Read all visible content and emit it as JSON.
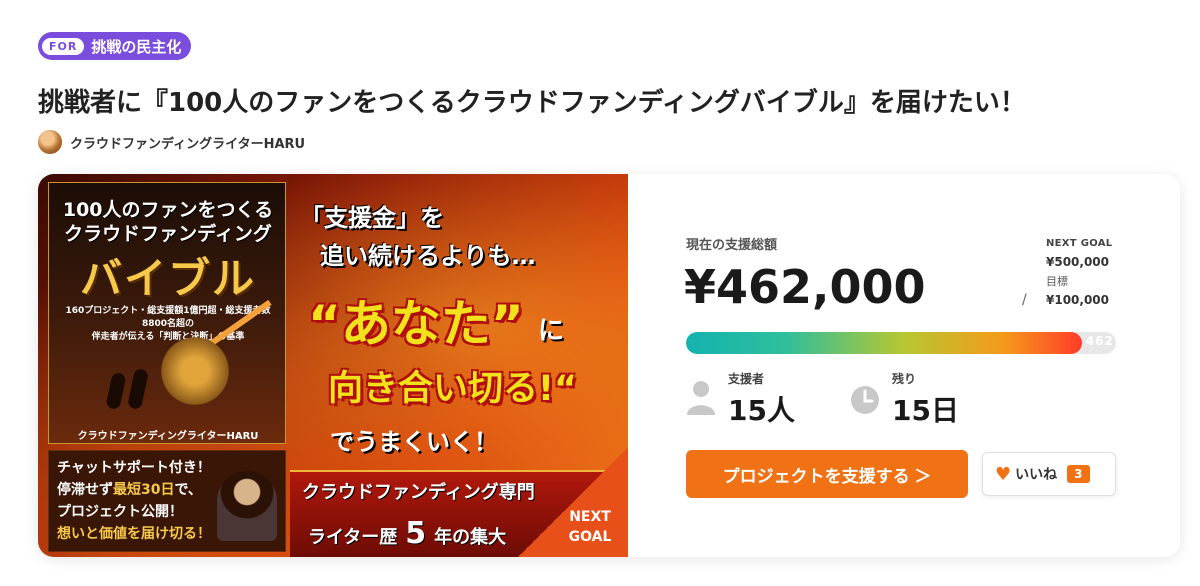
{
  "category": {
    "prefix": "FOR",
    "label": "挑戦の民主化"
  },
  "project": {
    "title": "挑戦者に『100人のファンをつくるクラウドファンディングバイブル』を届けたい！",
    "author": "クラウドファンディングライターHARU"
  },
  "image": {
    "book_title_1": "100人のファンをつくる",
    "book_title_2": "クラウドファンディング",
    "book_title_big": "バイブル",
    "book_subtitle_1": "160プロジェクト・総支援額1億円超・総支援者数8800名超の",
    "book_subtitle_2": "伴走者が伝える「判断と決断」の基準",
    "book_author": "クラウドファンディングライターHARU",
    "chat_line_1": "チャットサポート付き！",
    "chat_line_2a": "停滞せず",
    "chat_line_2b": "最短30日",
    "chat_line_2c": "で、",
    "chat_line_3": "プロジェクト公開！",
    "chat_line_4": "想いと価値を届け切る！",
    "headline_1": "「支援金」を",
    "headline_2": "追い続けるよりも…",
    "headline_3": "“あなた”",
    "headline_3_suffix": "に",
    "headline_4": "向き合い切る!“",
    "headline_5": "でうまくいく！",
    "banner_line_1": "クラウドファンディング専門",
    "banner_line_2a": "ライター歴",
    "banner_line_2b": "5",
    "banner_line_2c": "年の集大",
    "corner_line_1": "NEXT",
    "corner_line_2": "GOAL"
  },
  "stats": {
    "raised_label": "現在の支援総額",
    "raised_amount": "¥462,000",
    "next_goal_label": "NEXT GOAL",
    "next_goal_value": "¥500,000",
    "goal_label": "目標",
    "goal_value": "¥100,000",
    "separator": "/",
    "progress_text": "462 %",
    "progress_fraction": 0.92,
    "backers_label": "支援者",
    "backers_value": "15人",
    "remaining_label": "残り",
    "remaining_value": "15日"
  },
  "actions": {
    "support_label": "プロジェクトを支援する ＞",
    "like_label": "いいね",
    "like_count": "3"
  },
  "colors": {
    "accent": "#f07214",
    "category": "#7b4ddc"
  },
  "icons": {
    "backers": "person-icon",
    "remaining": "clock-icon",
    "like": "heart-icon"
  }
}
